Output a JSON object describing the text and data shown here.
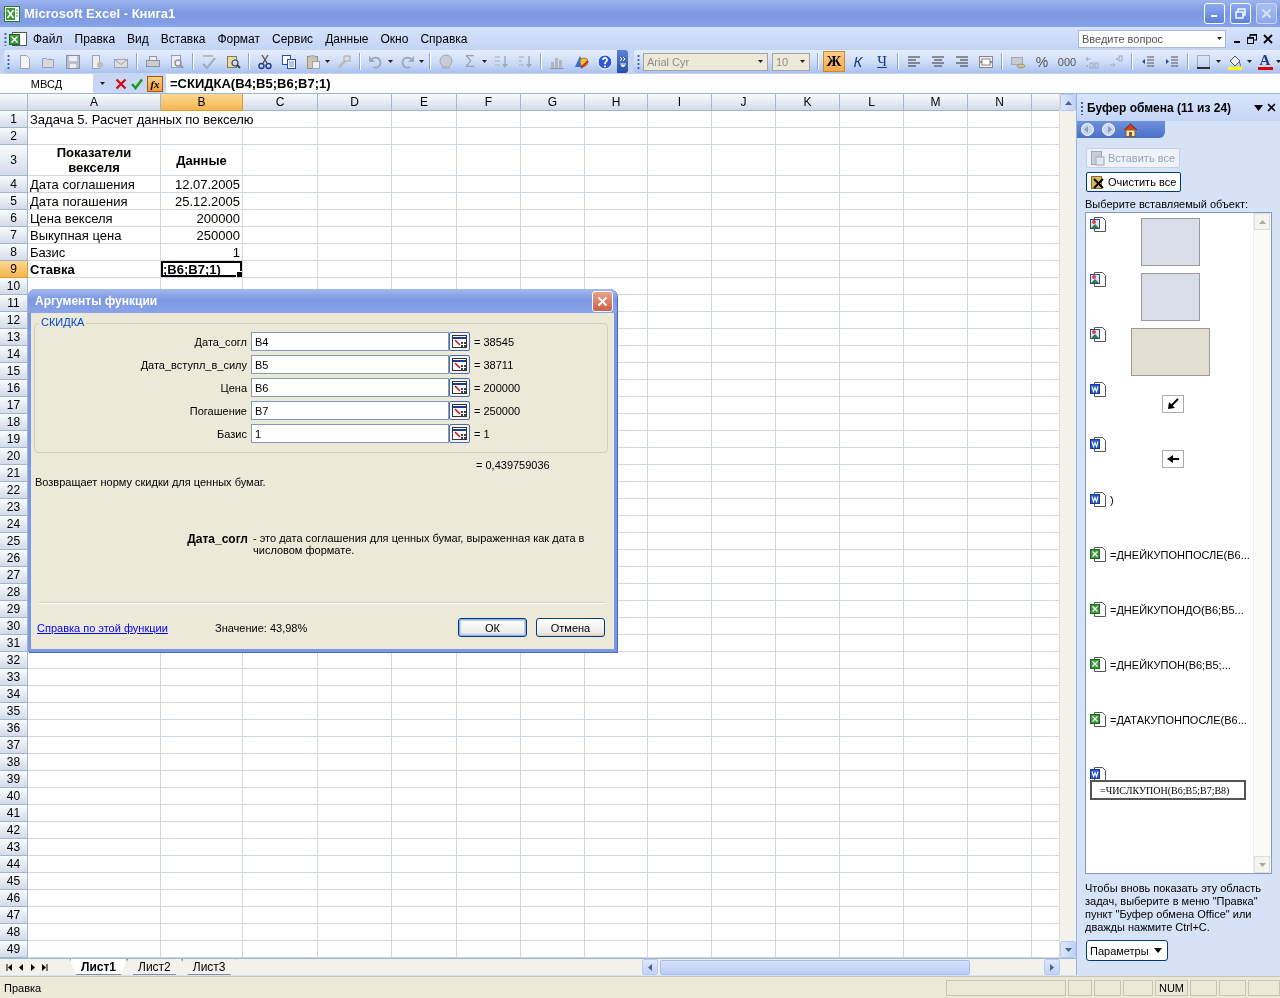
{
  "window": {
    "title": "Microsoft Excel - Книга1"
  },
  "menu": [
    "Файл",
    "Правка",
    "Вид",
    "Вставка",
    "Формат",
    "Сервис",
    "Данные",
    "Окно",
    "Справка"
  ],
  "help_search": {
    "placeholder": "Введите вопрос"
  },
  "standard_toolbar": {
    "autosum": "Σ"
  },
  "formatting_toolbar": {
    "font": {
      "value": "Arial Cyr",
      "disabled": true
    },
    "size": {
      "value": "10",
      "disabled": true
    },
    "styles": [
      {
        "kind": "bold",
        "label": "Ж",
        "selected": true
      },
      {
        "kind": "italic",
        "label": "К",
        "selected": false
      },
      {
        "kind": "underline",
        "label": "Ч",
        "selected": false
      }
    ],
    "percent": "%",
    "thousands": "000",
    "font_color": "A"
  },
  "formula_bar": {
    "name_box": "МВСД",
    "function_button": "fx",
    "formula": "=СКИДКА(B4;B5;B6;B7;1)"
  },
  "sheet": {
    "columns": [
      {
        "label": "A",
        "selected": false
      },
      {
        "label": "B",
        "selected": true
      },
      {
        "label": "C",
        "selected": false
      },
      {
        "label": "D",
        "selected": false
      },
      {
        "label": "E",
        "selected": false
      },
      {
        "label": "F",
        "selected": false
      },
      {
        "label": "G",
        "selected": false
      },
      {
        "label": "H",
        "selected": false
      },
      {
        "label": "I",
        "selected": false
      },
      {
        "label": "J",
        "selected": false
      },
      {
        "label": "K",
        "selected": false
      },
      {
        "label": "L",
        "selected": false
      },
      {
        "label": "M",
        "selected": false
      },
      {
        "label": "N",
        "selected": false
      }
    ],
    "rows": [
      {
        "label": "1",
        "selected": false,
        "cells": [
          {
            "kind": "title",
            "text": "Задача 5. Расчет данных по векселю",
            "selected": false
          }
        ]
      },
      {
        "label": "2",
        "selected": false
      },
      {
        "label": "3",
        "selected": false,
        "cells": [
          {
            "kind": "header",
            "text": "Показатели векселя",
            "selected": false
          },
          {
            "kind": "header",
            "text": "Данные",
            "selected": false
          }
        ]
      },
      {
        "label": "4",
        "selected": false,
        "cells": [
          {
            "kind": "text",
            "text": "Дата соглашения",
            "selected": false
          },
          {
            "kind": "number",
            "text": "12.07.2005",
            "selected": false
          }
        ]
      },
      {
        "label": "5",
        "selected": false,
        "cells": [
          {
            "kind": "text",
            "text": "Дата погашения",
            "selected": false
          },
          {
            "kind": "number",
            "text": "25.12.2005",
            "selected": false
          }
        ]
      },
      {
        "label": "6",
        "selected": false,
        "cells": [
          {
            "kind": "text",
            "text": "Цена векселя",
            "selected": false
          },
          {
            "kind": "number",
            "text": "200000",
            "selected": false
          }
        ]
      },
      {
        "label": "7",
        "selected": false,
        "cells": [
          {
            "kind": "text",
            "text": "Выкупная цена",
            "selected": false
          },
          {
            "kind": "number",
            "text": "250000",
            "selected": false
          }
        ]
      },
      {
        "label": "8",
        "selected": false,
        "cells": [
          {
            "kind": "text",
            "text": "Базис",
            "selected": false
          },
          {
            "kind": "number",
            "text": "1",
            "selected": false
          }
        ]
      },
      {
        "label": "9",
        "selected": true,
        "cells": [
          {
            "kind": "bold",
            "text": "Ставка",
            "selected": false
          },
          {
            "kind": "bold",
            "text": ";B6;B7;1)",
            "selected": true
          }
        ]
      },
      {
        "label": "10",
        "selected": false
      },
      {
        "label": "11",
        "selected": false
      },
      {
        "label": "12",
        "selected": false
      },
      {
        "label": "13",
        "selected": false
      },
      {
        "label": "14",
        "selected": false
      },
      {
        "label": "15",
        "selected": false
      },
      {
        "label": "16",
        "selected": false
      },
      {
        "label": "17",
        "selected": false
      },
      {
        "label": "18",
        "selected": false
      },
      {
        "label": "19",
        "selected": false
      },
      {
        "label": "20",
        "selected": false
      },
      {
        "label": "21",
        "selected": false
      },
      {
        "label": "22",
        "selected": false
      },
      {
        "label": "23",
        "selected": false
      },
      {
        "label": "24",
        "selected": false
      },
      {
        "label": "25",
        "selected": false
      },
      {
        "label": "26",
        "selected": false
      },
      {
        "label": "27",
        "selected": false
      },
      {
        "label": "28",
        "selected": false
      },
      {
        "label": "29",
        "selected": false
      },
      {
        "label": "30",
        "selected": false
      },
      {
        "label": "31",
        "selected": false
      },
      {
        "label": "32",
        "selected": false
      },
      {
        "label": "33",
        "selected": false
      },
      {
        "label": "34",
        "selected": false
      },
      {
        "label": "35",
        "selected": false
      },
      {
        "label": "36",
        "selected": false
      },
      {
        "label": "37",
        "selected": false
      },
      {
        "label": "38",
        "selected": false
      },
      {
        "label": "39",
        "selected": false
      },
      {
        "label": "40",
        "selected": false
      },
      {
        "label": "41",
        "selected": false
      },
      {
        "label": "42",
        "selected": false
      },
      {
        "label": "43",
        "selected": false
      },
      {
        "label": "44",
        "selected": false
      },
      {
        "label": "45",
        "selected": false
      },
      {
        "label": "46",
        "selected": false
      },
      {
        "label": "47",
        "selected": false
      },
      {
        "label": "48",
        "selected": false
      },
      {
        "label": "49",
        "selected": false
      }
    ]
  },
  "dialog": {
    "title": "Аргументы функции",
    "function": "СКИДКА",
    "arguments": [
      {
        "label": "Дата_согл",
        "value": "B4",
        "result": "= 38545"
      },
      {
        "label": "Дата_вступл_в_силу",
        "value": "B5",
        "result": "= 38711"
      },
      {
        "label": "Цена",
        "value": "B6",
        "result": "= 200000"
      },
      {
        "label": "Погашение",
        "value": "B7",
        "result": "= 250000"
      },
      {
        "label": "Базис",
        "value": "1",
        "result": "= 1"
      }
    ],
    "result": "= 0,439759036",
    "description": "Возвращает норму скидки для ценных бумаг.",
    "argument_help": {
      "name": "Дата_согл",
      "text": "- это дата соглашения для ценных бумаг, выраженная как дата в числовом формате."
    },
    "help_link": "Справка по этой функции",
    "value": "Значение: 43,98%",
    "buttons": [
      {
        "label": "ОК",
        "default": true
      },
      {
        "label": "Отмена",
        "default": false
      }
    ]
  },
  "sheet_tabs": [
    {
      "label": "Лист1",
      "selected": true
    },
    {
      "label": "Лист2",
      "selected": false
    },
    {
      "label": "Лист3",
      "selected": false
    }
  ],
  "task_pane": {
    "title": "Буфер обмена (11 из 24)",
    "buttons": [
      {
        "label": "Вставить все",
        "disabled": true
      },
      {
        "label": "Очистить все",
        "disabled": false
      }
    ],
    "prompt": "Выберите вставляемый объект:",
    "items": [
      {
        "kind": "screenshot",
        "source": {
          "kind": "picture"
        }
      },
      {
        "kind": "screenshot",
        "source": {
          "kind": "picture"
        }
      },
      {
        "kind": "dialog",
        "source": {
          "kind": "picture"
        }
      },
      {
        "kind": "pointer",
        "source": {
          "kind": "word"
        }
      },
      {
        "kind": "arrow",
        "source": {
          "kind": "word"
        }
      },
      {
        "kind": "text",
        "source": {
          "kind": "word"
        },
        "text": ")"
      },
      {
        "kind": "text",
        "source": {
          "kind": "excel"
        },
        "text": "=ДНЕЙКУПОНПОСЛЕ(B6..."
      },
      {
        "kind": "text",
        "source": {
          "kind": "excel"
        },
        "text": "=ДНЕЙКУПОНДО(B6;B5..."
      },
      {
        "kind": "text",
        "source": {
          "kind": "excel"
        },
        "text": "=ДНЕЙКУПОН(B6;B5;..."
      },
      {
        "kind": "text",
        "source": {
          "kind": "excel"
        },
        "text": "=ДАТАКУПОНПОСЛЕ(B6..."
      },
      {
        "kind": "framed",
        "source": {
          "kind": "word"
        },
        "text": "=ЧИСЛКУПОН(B6;B5;B7;B8)"
      }
    ],
    "note": "Чтобы вновь показать эту область задач, выберите в меню \"Правка\" пункт \"Буфер обмена Office\" или дважды нажмите Ctrl+C.",
    "options_button": "Параметры"
  },
  "status_bar": {
    "text": "Правка",
    "indicators": [
      "NUM"
    ]
  }
}
